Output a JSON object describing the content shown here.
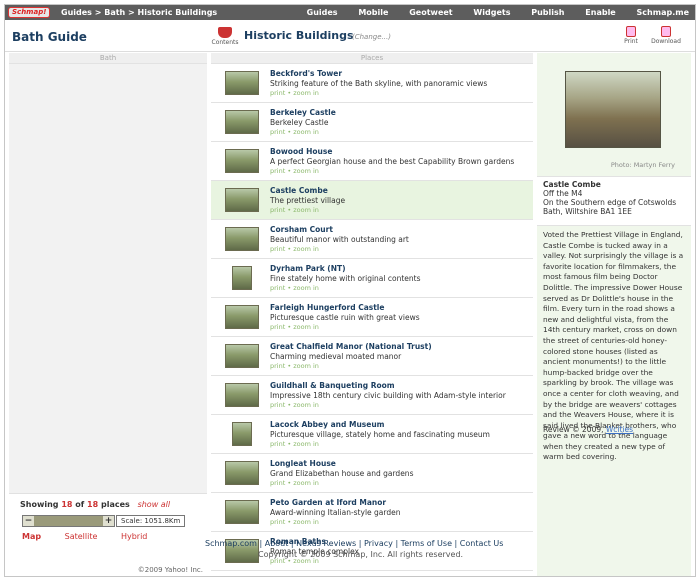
{
  "topbar": {
    "logo": "Schmap!",
    "breadcrumbs": [
      "Guides",
      "Bath",
      "Historic Buildings"
    ],
    "separator": ">",
    "nav": [
      "Guides",
      "Mobile",
      "Geotweet",
      "Widgets",
      "Publish",
      "Enable",
      "Schmap.me"
    ]
  },
  "header": {
    "app_title": "Bath Guide",
    "contents_label": "Contents",
    "page_title": "Historic Buildings",
    "change_label": "(Change...)",
    "print_label": "Print",
    "download_label": "Download"
  },
  "left": {
    "heading": "Bath",
    "showing_prefix": "Showing",
    "shown_count": "18",
    "of": "of",
    "total_count": "18",
    "places_word": "places",
    "show_all": "show all",
    "zoom_minus": "−",
    "zoom_plus": "+",
    "scale_label": "Scale: 1051.8Km",
    "map_tabs": [
      "Map",
      "Satellite",
      "Hybrid"
    ],
    "copyright": "©2009 Yahoo! Inc."
  },
  "center": {
    "heading": "Places",
    "items": [
      {
        "title": "Beckford's Tower",
        "desc": "Striking feature of the Bath skyline, with panoramic views",
        "links": "print • zoom in"
      },
      {
        "title": "Berkeley Castle",
        "desc": "Berkeley Castle",
        "links": "print • zoom in"
      },
      {
        "title": "Bowood House",
        "desc": "A perfect Georgian house and the best Capability Brown gardens",
        "links": "print • zoom in"
      },
      {
        "title": "Castle Combe",
        "desc": "The prettiest village",
        "links": "print • zoom in"
      },
      {
        "title": "Corsham Court",
        "desc": "Beautiful manor with outstanding art",
        "links": "print • zoom in"
      },
      {
        "title": "Dyrham Park (NT)",
        "desc": "Fine stately home with original contents",
        "links": "print • zoom in"
      },
      {
        "title": "Farleigh Hungerford Castle",
        "desc": "Picturesque castle ruin with great views",
        "links": "print • zoom in"
      },
      {
        "title": "Great Chalfield Manor (National Trust)",
        "desc": "Charming medieval moated manor",
        "links": "print • zoom in"
      },
      {
        "title": "Guildhall & Banqueting Room",
        "desc": "Impressive 18th century civic building with Adam-style interior",
        "links": "print • zoom in"
      },
      {
        "title": "Lacock Abbey and Museum",
        "desc": "Picturesque village, stately home and fascinating museum",
        "links": "print • zoom in"
      },
      {
        "title": "Longleat House",
        "desc": "Grand Elizabethan house and gardens",
        "links": "print • zoom in"
      },
      {
        "title": "Peto Garden at Iford Manor",
        "desc": "Award-winning Italian-style garden",
        "links": "print • zoom in"
      },
      {
        "title": "Roman Baths",
        "desc": "Roman temple complex",
        "links": "print • zoom in"
      }
    ]
  },
  "footer": {
    "links": "Schmap.com | About | Nexus Reviews | Privacy | Terms of Use | Contact Us",
    "copyright": "Copyright © 2009 Schmap, Inc. All rights reserved."
  },
  "right": {
    "photo_caption": "Photo: Martyn Ferry",
    "name": "Castle Combe",
    "address": [
      "Off the M4",
      "On the Southern edge of Cotswolds",
      "Bath, Wiltshire BA1 1EE"
    ],
    "description": "Voted the Prettiest Village in England, Castle Combe is tucked away in a valley. Not surprisingly the village is a favorite location for filmmakers, the most famous film being Doctor Dolittle. The impressive Dower House served as Dr Dolittle's house in the film. Every turn in the road shows a new and delightful vista, from the 14th century market, cross on down the street of centuries-old honey-colored stone houses (listed as ancient monuments!) to the little hump-backed bridge over the sparkling by brook. The village was once a center for cloth weaving, and by the bridge are weavers' cottages and the Weavers House, where it is said lived the Blanket brothers, who gave a new word to the language when they created a new type of warm bed covering.",
    "review_prefix": "Review © 2009,",
    "review_author": "Wcities"
  }
}
